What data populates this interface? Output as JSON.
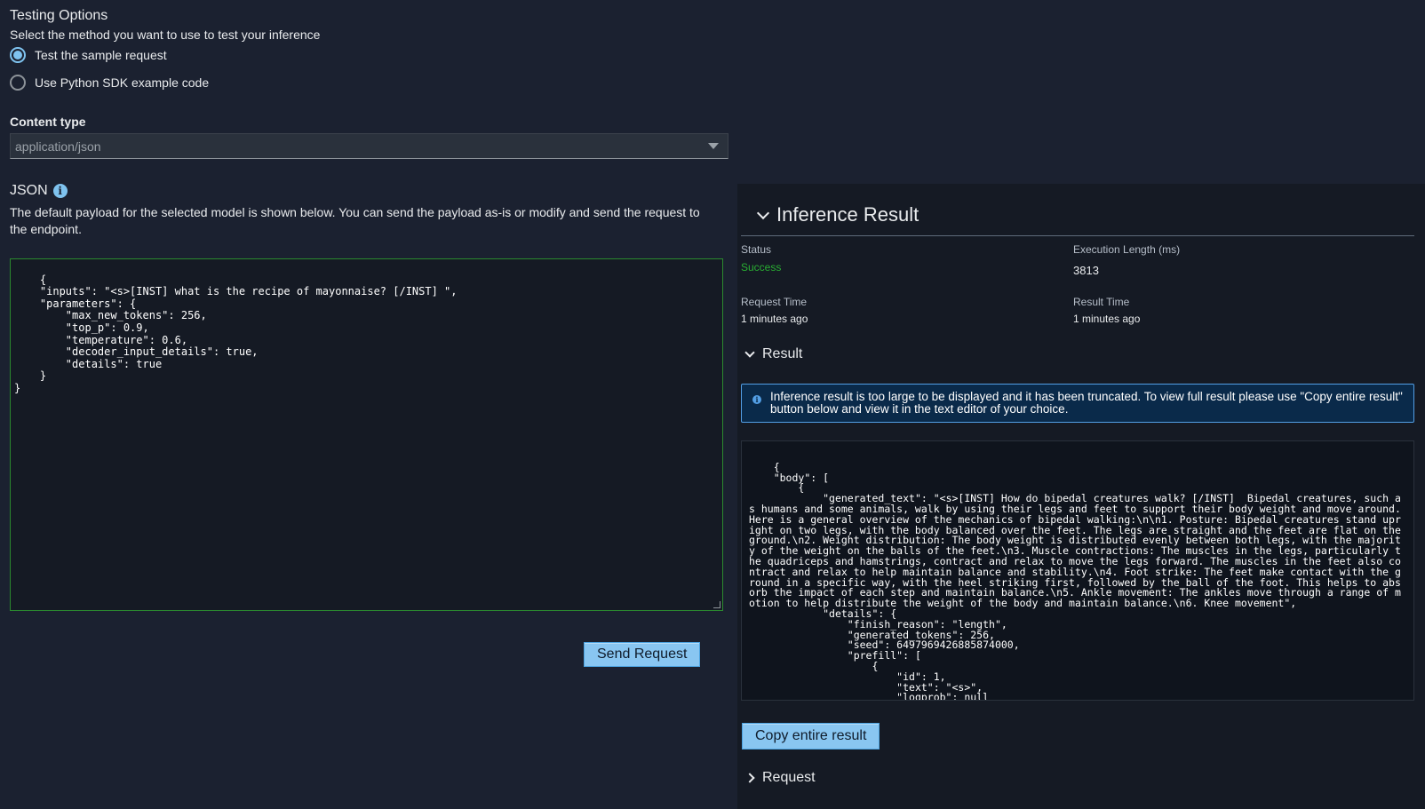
{
  "testing": {
    "title": "Testing Options",
    "description": "Select the method you want to use to test your inference",
    "options": [
      {
        "label": "Test the sample request",
        "selected": true
      },
      {
        "label": "Use Python SDK example code",
        "selected": false
      }
    ]
  },
  "content_type": {
    "label": "Content type",
    "value": "application/json"
  },
  "json_section": {
    "title": "JSON",
    "description": "The default payload for the selected model is shown below. You can send the payload as-is or modify and send the request to the endpoint.",
    "payload": "{\n    \"inputs\": \"<s>[INST] what is the recipe of mayonnaise? [/INST] \",\n    \"parameters\": {\n        \"max_new_tokens\": 256,\n        \"top_p\": 0.9,\n        \"temperature\": 0.6,\n        \"decoder_input_details\": true,\n        \"details\": true\n    }\n}",
    "send_label": "Send Request"
  },
  "inference_result": {
    "title": "Inference Result",
    "status_label": "Status",
    "status_value": "Success",
    "exec_label": "Execution Length (ms)",
    "exec_value": "3813",
    "request_time_label": "Request Time",
    "request_time_value": "1 minutes ago",
    "result_time_label": "Result Time",
    "result_time_value": "1 minutes ago",
    "result_section_title": "Result",
    "alert_text": "Inference result is too large to be displayed and it has been truncated. To view full result please use \"Copy entire result\" button below and view it in the text editor of your choice.",
    "result_text": "{\n    \"body\": [\n        {\n            \"generated_text\": \"<s>[INST] How do bipedal creatures walk? [/INST]  Bipedal creatures, such as humans and some animals, walk by using their legs and feet to support their body weight and move around. Here is a general overview of the mechanics of bipedal walking:\\n\\n1. Posture: Bipedal creatures stand upright on two legs, with the body balanced over the feet. The legs are straight and the feet are flat on the ground.\\n2. Weight distribution: The body weight is distributed evenly between both legs, with the majority of the weight on the balls of the feet.\\n3. Muscle contractions: The muscles in the legs, particularly the quadriceps and hamstrings, contract and relax to move the legs forward. The muscles in the feet also contract and relax to help maintain balance and stability.\\n4. Foot strike: The feet make contact with the ground in a specific way, with the heel striking first, followed by the ball of the foot. This helps to absorb the impact of each step and maintain balance.\\n5. Ankle movement: The ankles move through a range of motion to help distribute the weight of the body and maintain balance.\\n6. Knee movement\",\n            \"details\": {\n                \"finish_reason\": \"length\",\n                \"generated_tokens\": 256,\n                \"seed\": 6497969426885874000,\n                \"prefill\": [\n                    {\n                        \"id\": 1,\n                        \"text\": \"<s>\",\n                        \"logprob\": null",
    "copy_label": "Copy entire result",
    "request_section_title": "Request"
  }
}
